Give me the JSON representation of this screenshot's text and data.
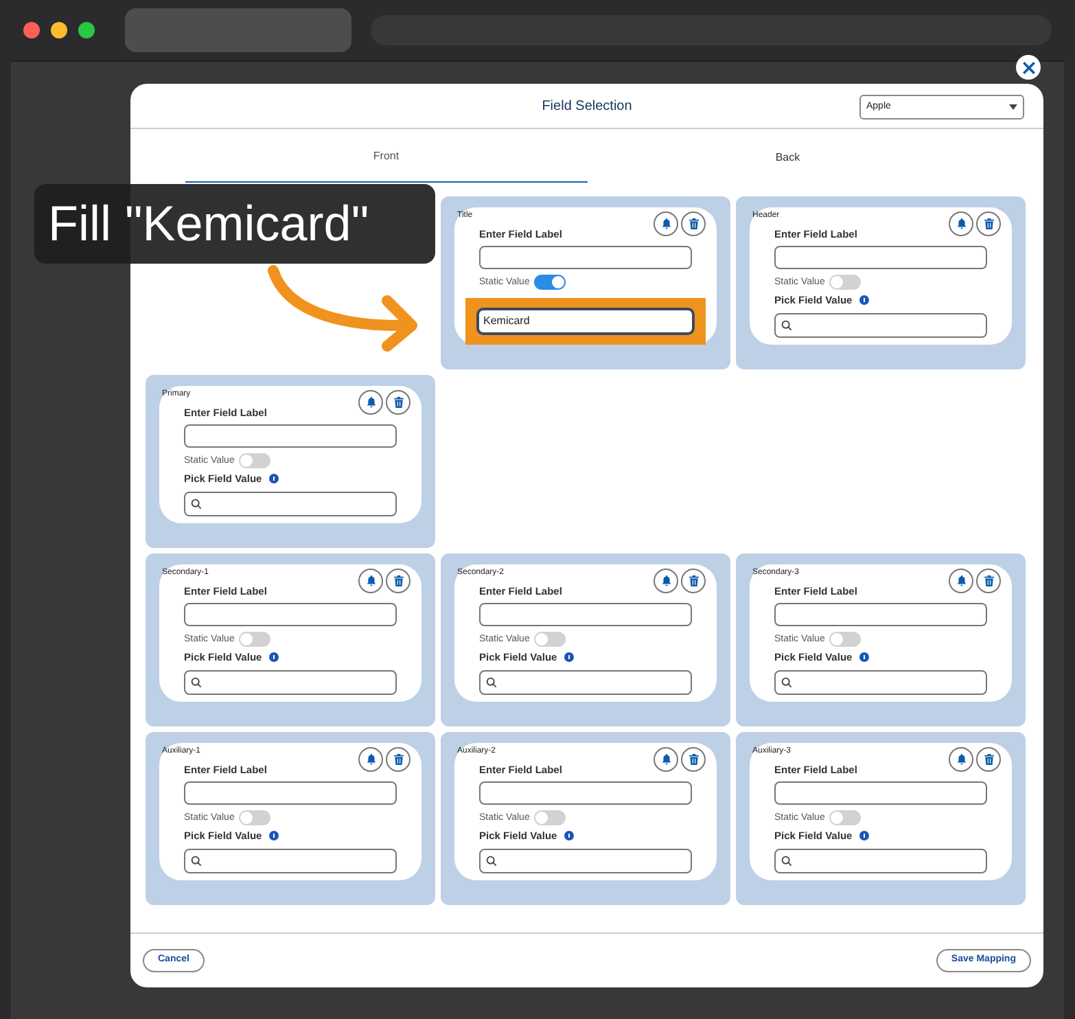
{
  "dialog": {
    "title": "Field Selection",
    "dropdown": {
      "value": "Apple"
    },
    "tabs": [
      {
        "label": "Front",
        "selected": true
      },
      {
        "label": "Back",
        "selected": false
      }
    ],
    "rows": [
      {
        "items": [
          {
            "kind": "pointer"
          },
          {
            "kind": "field_card",
            "label": "Title",
            "field_label": "Enter Field Label",
            "static_label": "Static Value",
            "static_on": true,
            "static_value": "Kemicard",
            "highlighted": true
          },
          {
            "kind": "field_card",
            "label": "Header",
            "field_label": "Enter Field Label",
            "static_label": "Static Value",
            "static_on": false,
            "pick_label": "Pick Field Value"
          }
        ]
      },
      {
        "items": [
          {
            "kind": "field_card",
            "label": "Primary",
            "field_label": "Enter Field Label",
            "static_label": "Static Value",
            "static_on": false,
            "pick_label": "Pick Field Value"
          }
        ]
      },
      {
        "items": [
          {
            "kind": "field_card",
            "label": "Secondary-1",
            "field_label": "Enter Field Label",
            "static_label": "Static Value",
            "static_on": false,
            "pick_label": "Pick Field Value"
          },
          {
            "kind": "field_card",
            "label": "Secondary-2",
            "field_label": "Enter Field Label",
            "static_label": "Static Value",
            "static_on": false,
            "pick_label": "Pick Field Value"
          },
          {
            "kind": "field_card",
            "label": "Secondary-3",
            "field_label": "Enter Field Label",
            "static_label": "Static Value",
            "static_on": false,
            "pick_label": "Pick Field Value"
          }
        ]
      },
      {
        "items": [
          {
            "kind": "field_card",
            "label": "Auxiliary-1",
            "field_label": "Enter Field Label",
            "static_label": "Static Value",
            "static_on": false,
            "pick_label": "Pick Field Value"
          },
          {
            "kind": "field_card",
            "label": "Auxiliary-2",
            "field_label": "Enter Field Label",
            "static_label": "Static Value",
            "static_on": false,
            "pick_label": "Pick Field Value"
          },
          {
            "kind": "field_card",
            "label": "Auxiliary-3",
            "field_label": "Enter Field Label",
            "static_label": "Static Value",
            "static_on": false,
            "pick_label": "Pick Field Value"
          }
        ]
      }
    ],
    "buttons": [
      {
        "label": "Cancel"
      },
      {
        "label": "Save Mapping"
      }
    ]
  },
  "callout": {
    "text": "Fill \"Kemicard\""
  }
}
